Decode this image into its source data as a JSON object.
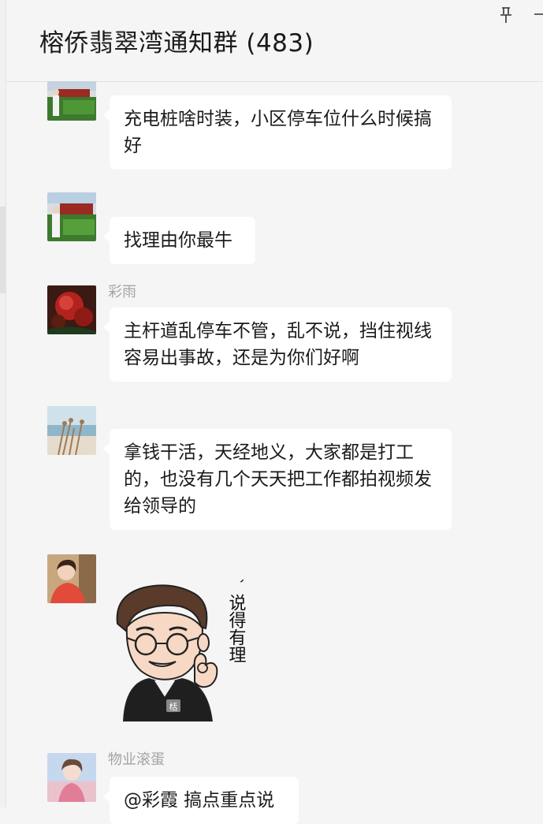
{
  "header": {
    "title": "榕侨翡翠湾通知群 (483)"
  },
  "icons": {
    "pin": "pin-icon",
    "more": "more-icon"
  },
  "messages": [
    {
      "sender": "",
      "text": "充电桩啥时装，小区停车位什么时候搞好"
    },
    {
      "sender": "",
      "text": "找理由你最牛"
    },
    {
      "sender": "彩雨",
      "text": "主杆道乱停车不管，乱不说，挡住视线容易出事故，还是为你们好啊"
    },
    {
      "sender": "",
      "text": "拿钱干活，天经地义，大家都是打工的，也没有几个天天把工作都拍视频发给领导的"
    },
    {
      "sender": "",
      "text": "",
      "sticker_text": "噢，说得有理",
      "sticker_badge": "栝"
    },
    {
      "sender": "物业滚蛋",
      "text": "@彩霞 搞点重点说"
    }
  ],
  "colors": {
    "background": "#f5f5f5",
    "bubble": "#ffffff",
    "sender": "#a3a3a3"
  }
}
